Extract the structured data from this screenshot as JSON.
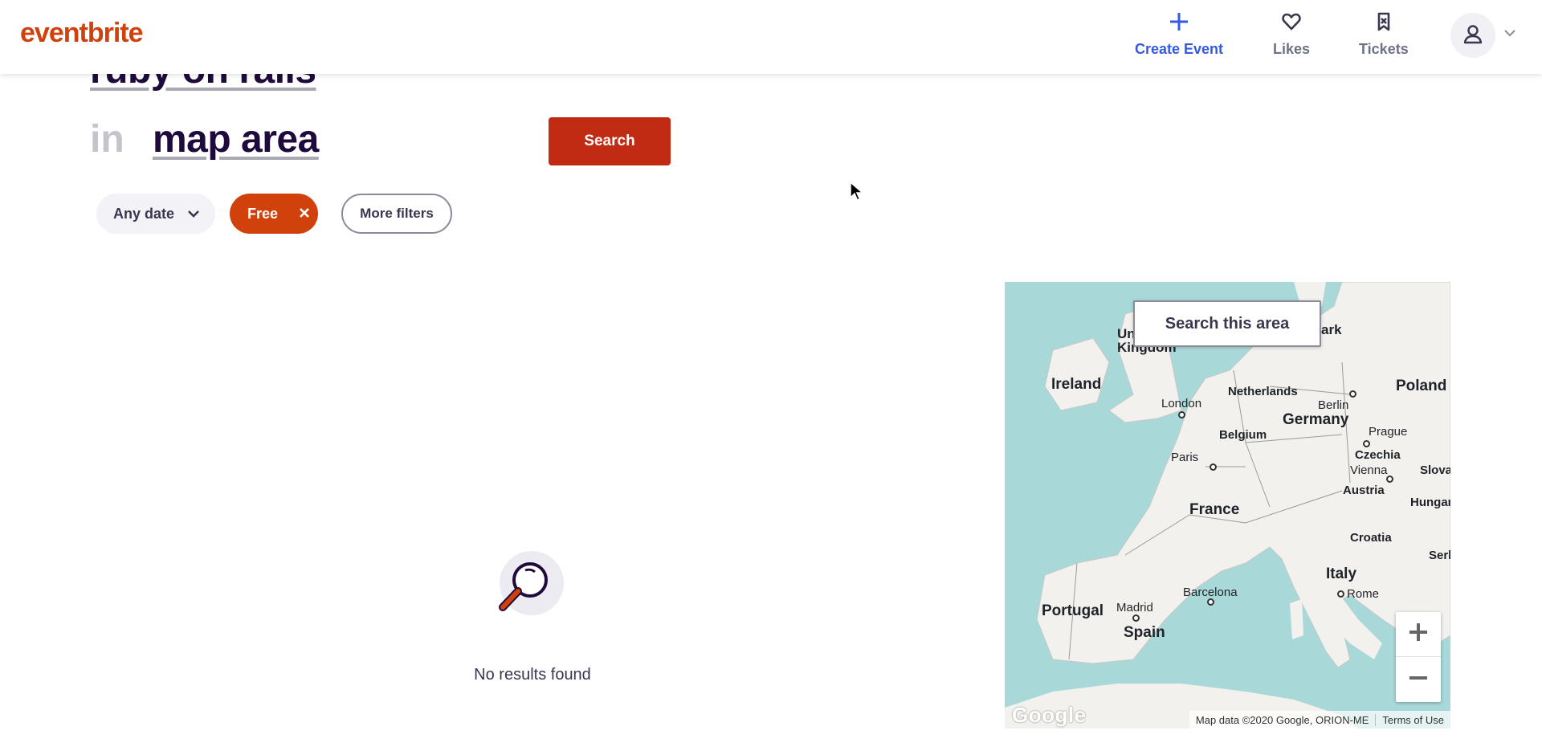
{
  "header": {
    "logo": "eventbrite",
    "nav": {
      "create_event": "Create Event",
      "likes": "Likes",
      "tickets": "Tickets"
    },
    "icons": {
      "create": "plus-icon",
      "likes": "heart-icon",
      "tickets": "ticket-icon",
      "avatar": "user-icon",
      "menu": "chevron-down-icon"
    }
  },
  "search": {
    "query": "ruby on rails",
    "location_prefix": "in",
    "location": "map area",
    "button": "Search"
  },
  "filters": {
    "date": "Any date",
    "price": "Free",
    "more": "More filters"
  },
  "results": {
    "empty_message": "No results found"
  },
  "map": {
    "search_area_button": "Search this area",
    "attribution": "Map data ©2020 Google, ORION-ME",
    "terms": "Terms of Use",
    "google_logo": "Google",
    "countries": [
      "United Kingdom",
      "Ireland",
      "Netherlands",
      "Germany",
      "Belgium",
      "Poland",
      "Czechia",
      "Austria",
      "Slovakia",
      "Hungary",
      "France",
      "Croatia",
      "Serbia",
      "Italy",
      "Portugal",
      "Spain",
      "Denmark"
    ],
    "country_labels": {
      "ireland": "Ireland",
      "uk_top": "United",
      "uk": "Kingdom",
      "netherlands": "Netherlands",
      "germany": "Germany",
      "belgium": "Belgium",
      "poland": "Poland",
      "czechia": "Czechia",
      "austria": "Austria",
      "slovakia": "Slova",
      "hungary": "Hungar",
      "france": "France",
      "croatia": "Croatia",
      "serbia": "Serb",
      "italy": "Italy",
      "portugal": "Portugal",
      "spain": "Spain",
      "denmark": "ark"
    },
    "city_labels": {
      "london": "London",
      "berlin": "Berlin",
      "prague": "Prague",
      "paris": "Paris",
      "vienna": "Vienna",
      "madrid": "Madrid",
      "barcelona": "Barcelona",
      "rome": "Rome"
    },
    "colors": {
      "water": "#a8d8d8",
      "land": "#f2f1ee",
      "border": "#9a9a9a"
    }
  },
  "colors": {
    "brand": "#d1410c",
    "search_button": "#c12b13",
    "create_event": "#3659e3",
    "text_dark": "#1e0a3c"
  }
}
